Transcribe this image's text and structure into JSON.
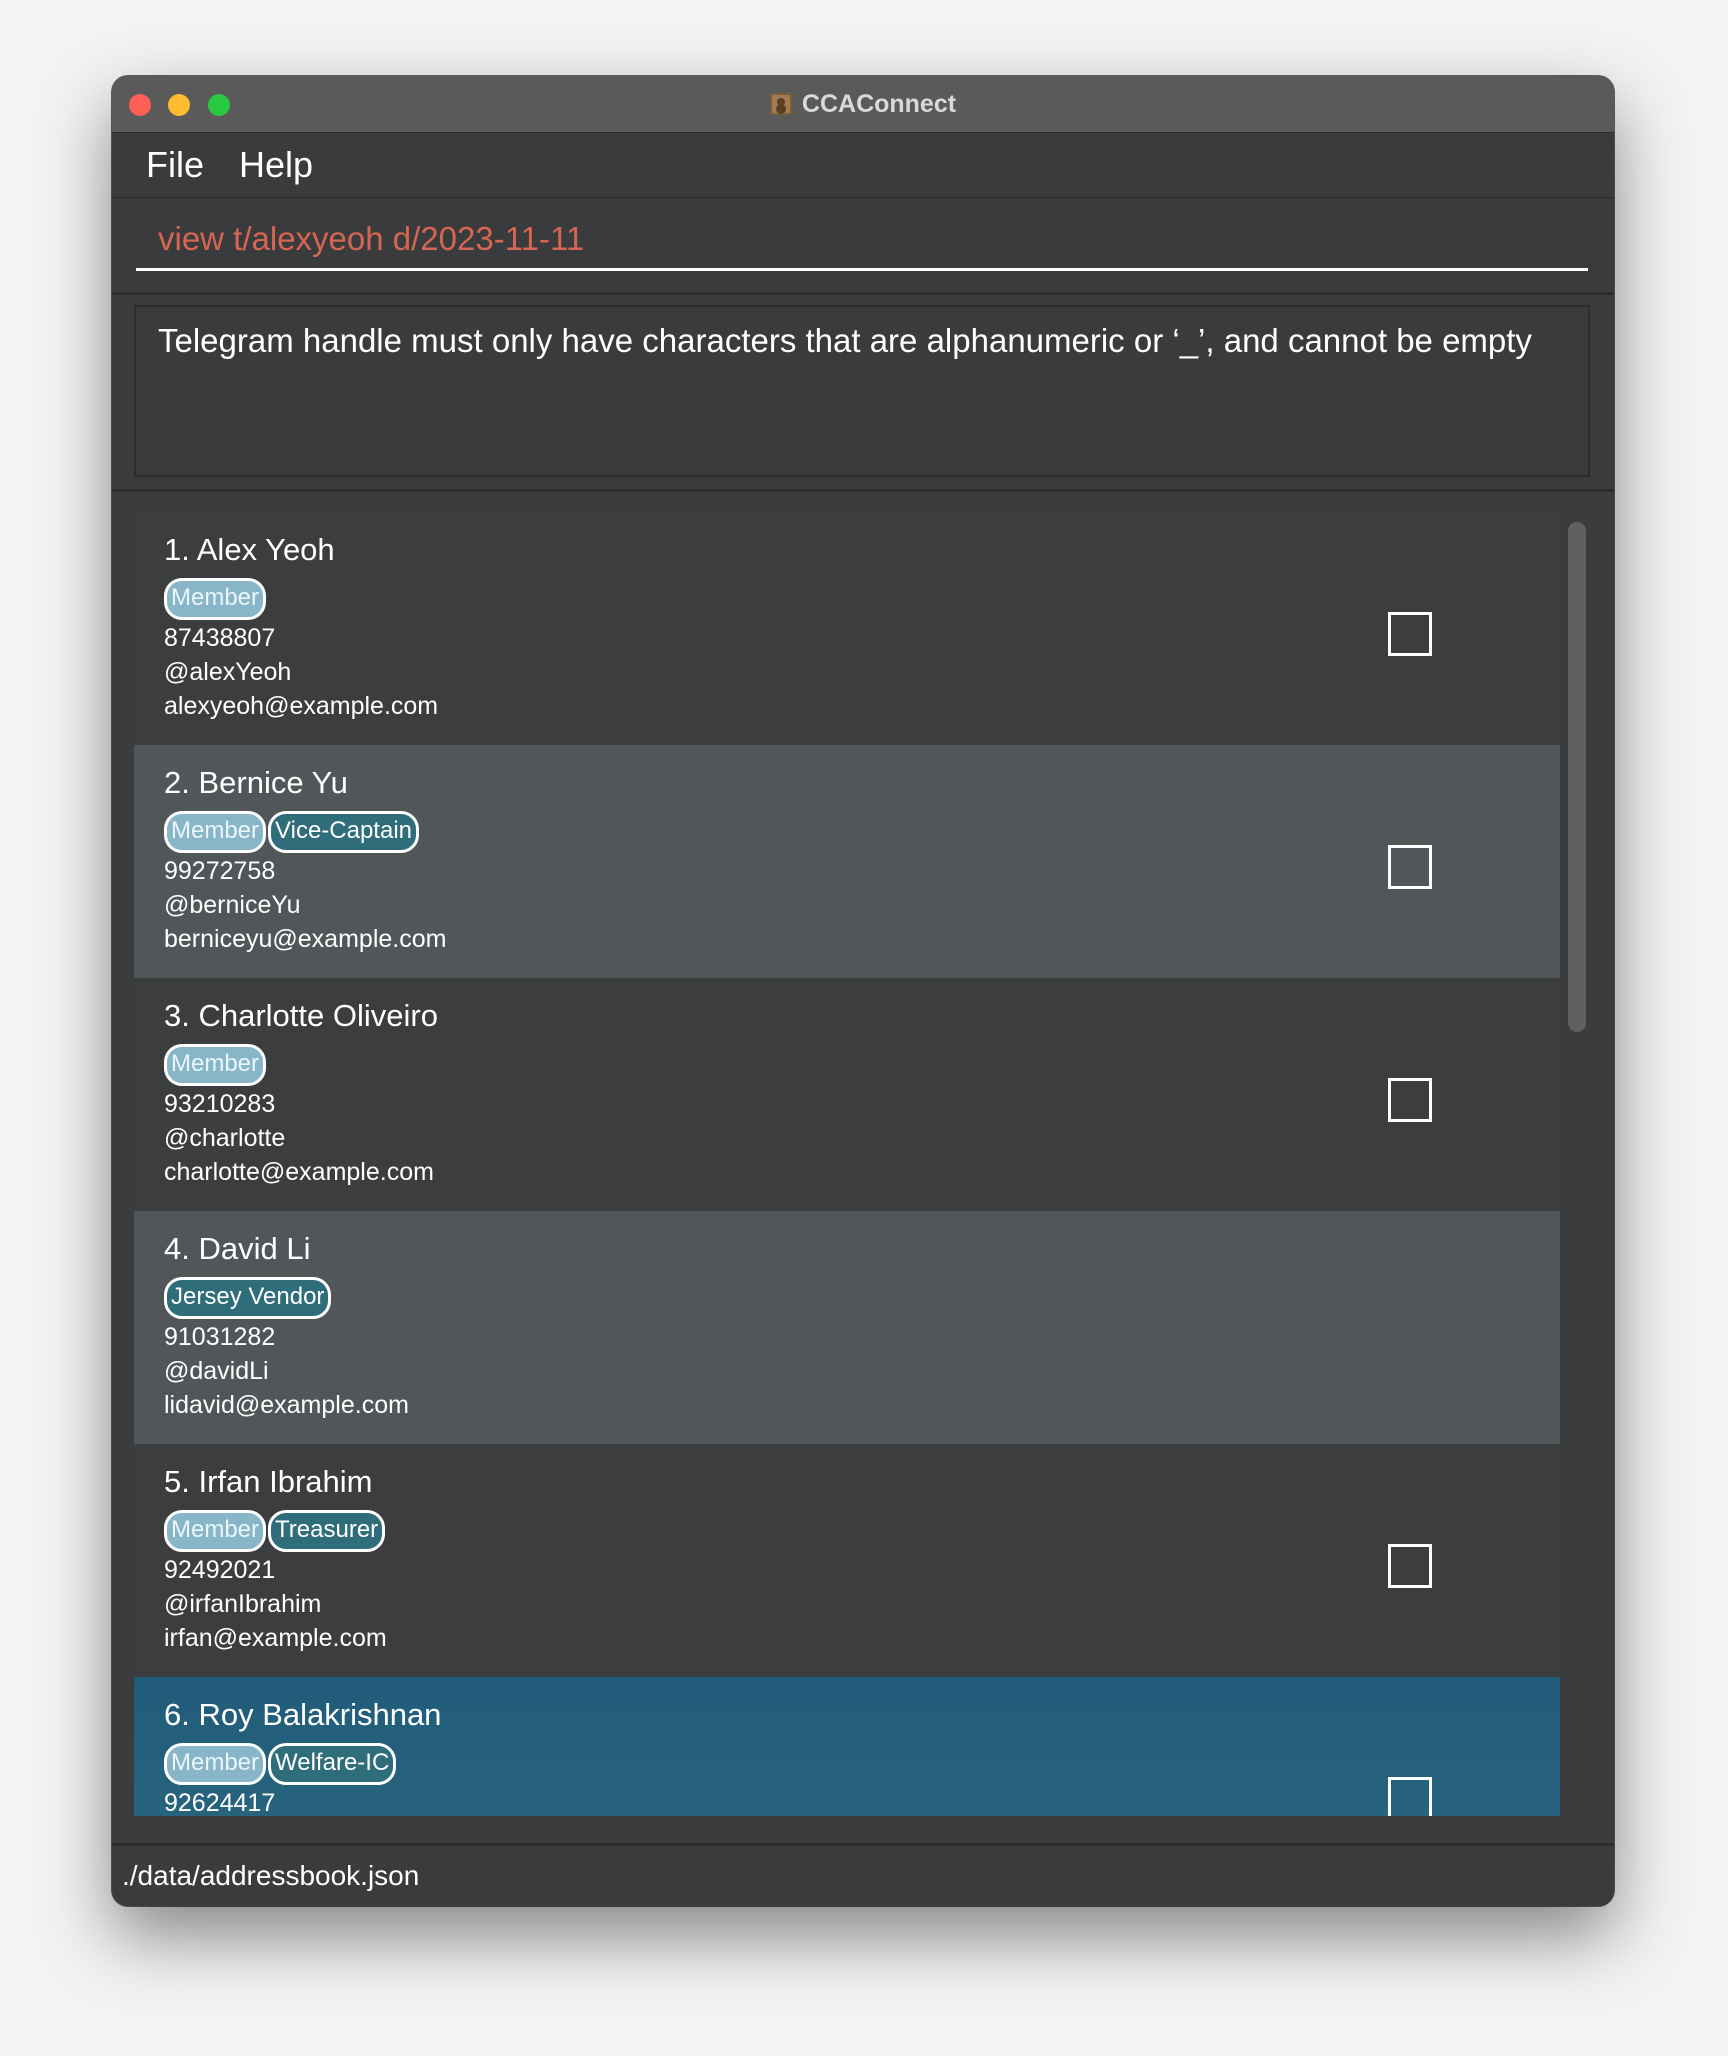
{
  "window": {
    "title": "CCAConnect"
  },
  "menu": {
    "file": "File",
    "help": "Help"
  },
  "command": {
    "value": "view t/alexyeoh d/2023-11-11"
  },
  "result": {
    "message": "Telegram handle must only have characters that are alphanumeric or ‘_’, and cannot be empty"
  },
  "members": [
    {
      "name": "1. Alex Yeoh",
      "tags": [
        {
          "label": "Member",
          "kind": "member"
        }
      ],
      "phone": "87438807",
      "telegram": "@alexYeoh",
      "email": "alexyeoh@example.com",
      "has_checkbox": true
    },
    {
      "name": "2. Bernice Yu",
      "tags": [
        {
          "label": "Member",
          "kind": "member"
        },
        {
          "label": "Vice-Captain",
          "kind": "role"
        }
      ],
      "phone": "99272758",
      "telegram": "@berniceYu",
      "email": "berniceyu@example.com",
      "has_checkbox": true
    },
    {
      "name": "3. Charlotte Oliveiro",
      "tags": [
        {
          "label": "Member",
          "kind": "member"
        }
      ],
      "phone": "93210283",
      "telegram": "@charlotte",
      "email": "charlotte@example.com",
      "has_checkbox": true
    },
    {
      "name": "4. David Li",
      "tags": [
        {
          "label": "Jersey Vendor",
          "kind": "role"
        }
      ],
      "phone": "91031282",
      "telegram": "@davidLi",
      "email": "lidavid@example.com",
      "has_checkbox": false
    },
    {
      "name": "5. Irfan Ibrahim",
      "tags": [
        {
          "label": "Member",
          "kind": "member"
        },
        {
          "label": "Treasurer",
          "kind": "role"
        }
      ],
      "phone": "92492021",
      "telegram": "@irfanIbrahim",
      "email": "irfan@example.com",
      "has_checkbox": true
    },
    {
      "name": "6. Roy Balakrishnan",
      "tags": [
        {
          "label": "Member",
          "kind": "member"
        },
        {
          "label": "Welfare-IC",
          "kind": "role"
        }
      ],
      "phone": "92624417",
      "telegram": "",
      "email": "",
      "has_checkbox": true,
      "selected": true
    }
  ],
  "status": {
    "path": "./data/addressbook.json"
  },
  "colors": {
    "command_text": "#d66651",
    "selected_row": "#215b7a",
    "member_tag": "#88b6c8",
    "role_tag": "#2f6d7a"
  }
}
